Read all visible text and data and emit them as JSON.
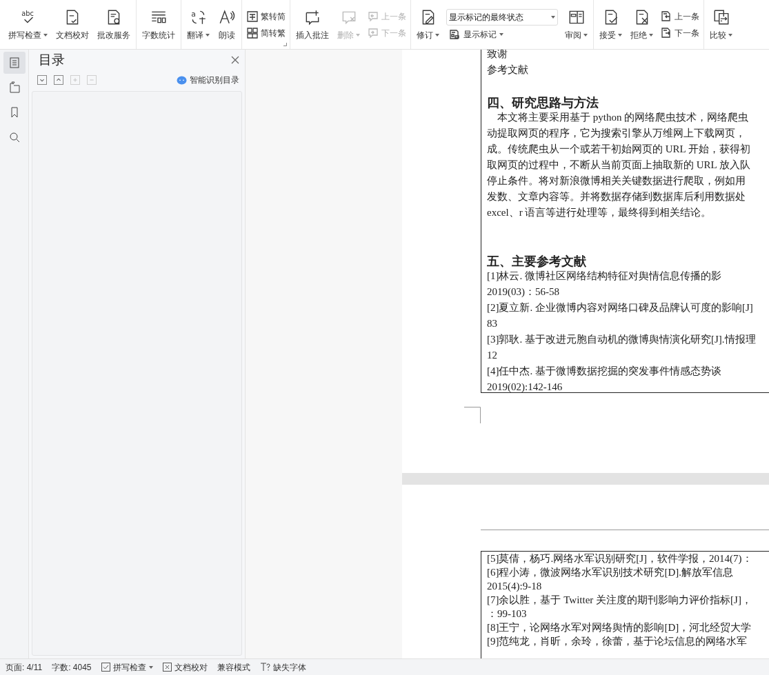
{
  "toolbar": {
    "groups": [
      {
        "launcher": false,
        "items": [
          {
            "kind": "large",
            "label": "拼写检查",
            "icon_text": "abc",
            "dropdown": true,
            "disabled": false
          },
          {
            "kind": "large",
            "label": "文档校对",
            "dropdown": false,
            "disabled": false
          },
          {
            "kind": "large",
            "label": "批改服务",
            "dropdown": false,
            "disabled": false
          }
        ]
      },
      {
        "launcher": false,
        "items": [
          {
            "kind": "large",
            "label": "字数统计",
            "dropdown": false,
            "disabled": false
          }
        ]
      },
      {
        "launcher": false,
        "items": [
          {
            "kind": "large",
            "label": "翻译",
            "icon_text": "a",
            "dropdown": true,
            "disabled": false
          },
          {
            "kind": "large",
            "label": "朗读",
            "dropdown": false,
            "disabled": false
          }
        ]
      },
      {
        "launcher": true,
        "items": [
          {
            "kind": "pair",
            "rows": [
              {
                "label": "繁转简",
                "disabled": false
              },
              {
                "label": "简转繁",
                "disabled": false
              }
            ]
          }
        ]
      },
      {
        "launcher": false,
        "items": [
          {
            "kind": "large",
            "label": "插入批注",
            "dropdown": false,
            "disabled": false
          },
          {
            "kind": "large",
            "label": "删除",
            "dropdown": true,
            "disabled": true
          },
          {
            "kind": "pair",
            "rows": [
              {
                "label": "上一条",
                "disabled": true
              },
              {
                "label": "下一条",
                "disabled": true
              }
            ]
          }
        ]
      },
      {
        "launcher": false,
        "items": [
          {
            "kind": "large",
            "label": "修订",
            "dropdown": true,
            "disabled": false
          },
          {
            "kind": "stack",
            "select": {
              "value": "显示标记的最终状态"
            },
            "below": {
              "label": "显示标记",
              "dropdown": true
            }
          },
          {
            "kind": "large",
            "label": "审阅",
            "dropdown": true,
            "disabled": false
          }
        ]
      },
      {
        "launcher": false,
        "items": [
          {
            "kind": "large",
            "label": "接受",
            "dropdown": true,
            "disabled": false
          },
          {
            "kind": "large",
            "label": "拒绝",
            "dropdown": true,
            "disabled": false
          },
          {
            "kind": "pair",
            "rows": [
              {
                "label": "上一条",
                "disabled": false
              },
              {
                "label": "下一条",
                "disabled": false
              }
            ]
          }
        ]
      },
      {
        "launcher": false,
        "items": [
          {
            "kind": "large",
            "label": "比较",
            "dropdown": true,
            "disabled": false
          }
        ]
      }
    ]
  },
  "side_tabs": [
    {
      "selected": true
    },
    {
      "selected": false
    },
    {
      "selected": false
    },
    {
      "selected": false
    }
  ],
  "toc_panel": {
    "title": "目录",
    "buttons": [
      {
        "disabled": false
      },
      {
        "disabled": false
      },
      {
        "disabled": true
      },
      {
        "disabled": true
      }
    ],
    "smart_button": "智能识别目录"
  },
  "pages": [
    {
      "kind": "first",
      "lines": [
        {
          "kind": "text",
          "text": "致谢"
        },
        {
          "kind": "text",
          "text": "参考文献"
        },
        {
          "kind": "blank"
        },
        {
          "kind": "heading",
          "text": "四、研究思路与方法"
        },
        {
          "kind": "text",
          "text": "　本文将主要采用基于 python 的网络爬虫技术，网络爬虫"
        },
        {
          "kind": "text",
          "text": "动提取网页的程序，它为搜索引擎从万维网上下载网页，"
        },
        {
          "kind": "text",
          "text": "成。传统爬虫从一个或若干初始网页的 URL 开始，获得初"
        },
        {
          "kind": "text",
          "text": "取网页的过程中，不断从当前页面上抽取新的 URL 放入队"
        },
        {
          "kind": "text",
          "text": "停止条件。将对新浪微博相关关键数据进行爬取，例如用"
        },
        {
          "kind": "text",
          "text": "发数、文章内容等。并将数据存储到数据库后利用数据处"
        },
        {
          "kind": "text",
          "text": "excel、r 语言等进行处理等，最终得到相关结论。"
        },
        {
          "kind": "blank"
        },
        {
          "kind": "blank"
        },
        {
          "kind": "heading",
          "text": "五、主要参考文献"
        },
        {
          "kind": "text",
          "text": "[1]林云. 微博社区网络结构特征对舆情信息传播的影"
        },
        {
          "kind": "text",
          "text": "2019(03)：56-58"
        },
        {
          "kind": "text",
          "text": "[2]夏立新. 企业微博内容对网络口碑及品牌认可度的影响[J]"
        },
        {
          "kind": "text",
          "text": "83"
        },
        {
          "kind": "text",
          "text": "[3]郭耿. 基于改进元胞自动机的微博舆情演化研究[J].情报理"
        },
        {
          "kind": "text",
          "text": "12"
        },
        {
          "kind": "text",
          "text": "[4]任中杰. 基于微博数据挖掘的突发事件情感态势谈"
        },
        {
          "kind": "text",
          "text": "2019(02):142-146"
        }
      ]
    },
    {
      "kind": "next",
      "lines": [
        {
          "kind": "text",
          "text": "[5]莫倩，杨巧.网络水军识别研究[J]，软件学报，2014(7)："
        },
        {
          "kind": "text",
          "text": "[6]程小涛，微波网络水军识别技术研究[D].解放军信息"
        },
        {
          "kind": "text",
          "text": "2015(4):9-18"
        },
        {
          "kind": "text",
          "text": "[7]余以胜，基于 Twitter 关注度的期刊影响力评价指标[J]，"
        },
        {
          "kind": "text",
          "text": "：99-103"
        },
        {
          "kind": "text",
          "text": "[8]王宁，论网络水军对网络舆情的影响[D]，河北经贸大学"
        },
        {
          "kind": "text",
          "text": "[9]范纯龙，肖昕，余玲，徐蕾，基于论坛信息的网络水军"
        }
      ]
    }
  ],
  "status_bar": [
    {
      "kind": "text",
      "text": "页面: 4/11"
    },
    {
      "kind": "text",
      "text": "字数: 4045"
    },
    {
      "kind": "check",
      "text": "拼写检查",
      "dropdown": true
    },
    {
      "kind": "xbox",
      "text": "文档校对",
      "dropdown": false
    },
    {
      "kind": "text",
      "text": "兼容模式"
    },
    {
      "kind": "font",
      "text": "缺失字体",
      "dropdown": false
    }
  ]
}
